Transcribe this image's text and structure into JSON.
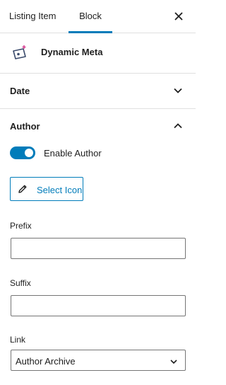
{
  "tabs": [
    {
      "label": "Listing Item"
    },
    {
      "label": "Block",
      "active": true
    }
  ],
  "block": {
    "title": "Dynamic Meta",
    "icon": "dynamic-meta-icon"
  },
  "panels": {
    "date": {
      "title": "Date",
      "expanded": false
    },
    "author": {
      "title": "Author",
      "expanded": true
    }
  },
  "author": {
    "enable_toggle": {
      "label": "Enable Author",
      "on": true
    },
    "select_icon_label": "Select Icon",
    "prefix": {
      "label": "Prefix",
      "value": ""
    },
    "suffix": {
      "label": "Suffix",
      "value": ""
    },
    "link": {
      "label": "Link",
      "selected": "Author Archive"
    }
  },
  "colors": {
    "accent": "#007cba",
    "border": "#e0e0e0",
    "text": "#1e1e1e"
  }
}
